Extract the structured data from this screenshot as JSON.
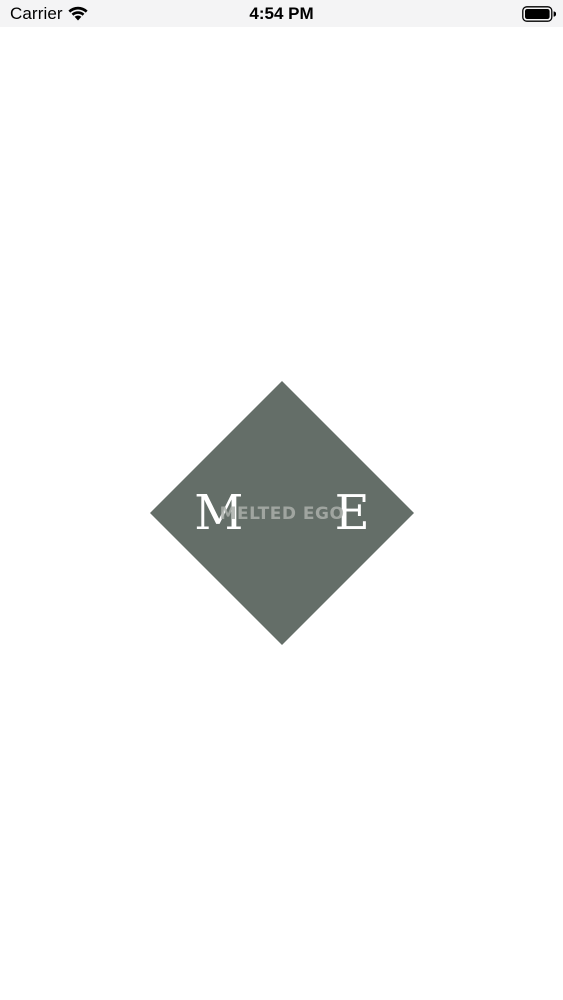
{
  "status_bar": {
    "carrier": "Carrier",
    "time": "4:54 PM",
    "wifi_icon": "wifi-icon",
    "battery_icon": "battery-icon"
  },
  "logo": {
    "monogram": "M E",
    "name": "MELTED EGO",
    "diamond_color": "#646e68"
  }
}
